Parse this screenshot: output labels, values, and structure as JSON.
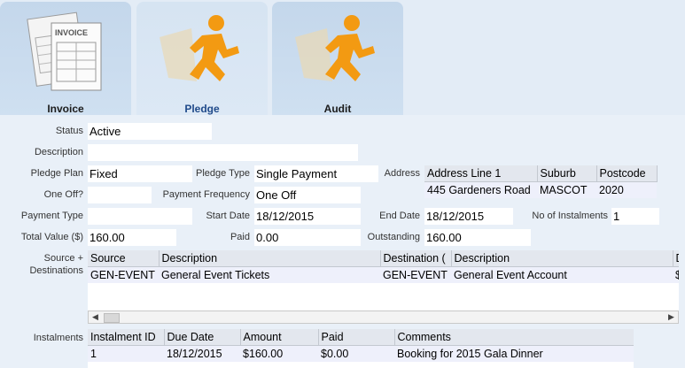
{
  "tabs": [
    {
      "label": "Invoice",
      "icon": "invoice-icon"
    },
    {
      "label": "Pledge",
      "icon": "running-man-icon"
    },
    {
      "label": "Audit",
      "icon": "running-man-icon"
    }
  ],
  "colors": {
    "accent": "#1f4a8a",
    "background": "#e3ecf6",
    "runner": "#f39a12"
  },
  "invoice_icon_text": "INVOICE",
  "form": {
    "status_label": "Status",
    "status": "Active",
    "description_label": "Description",
    "description": "",
    "pledge_plan_label": "Pledge Plan",
    "pledge_plan": "Fixed",
    "pledge_type_label": "Pledge Type",
    "pledge_type": "Single Payment",
    "address_label": "Address",
    "one_off_label": "One Off?",
    "one_off": "",
    "payment_frequency_label": "Payment Frequency",
    "payment_frequency": "One Off",
    "payment_type_label": "Payment Type",
    "payment_type": "",
    "start_date_label": "Start Date",
    "start_date": "18/12/2015",
    "end_date_label": "End Date",
    "end_date": "18/12/2015",
    "no_instalments_label": "No of Instalments",
    "no_instalments": "1",
    "total_value_label": "Total Value ($)",
    "total_value": "160.00",
    "paid_label": "Paid",
    "paid": "0.00",
    "outstanding_label": "Outstanding",
    "outstanding": "160.00"
  },
  "address_table": {
    "headers": [
      "Address Line 1",
      "Suburb",
      "Postcode"
    ],
    "row": [
      "445 Gardeners Road",
      "MASCOT",
      "2020"
    ]
  },
  "source_dest": {
    "label_line1": "Source +",
    "label_line2": "Destinations",
    "headers": [
      "Source",
      "Description",
      "Destination (",
      "Description",
      "D"
    ],
    "row": [
      "GEN-EVENT",
      "General Event Tickets",
      "GEN-EVENT",
      "General Event Account",
      "$"
    ]
  },
  "instalments": {
    "label": "Instalments",
    "headers": [
      "Instalment ID",
      "Due Date",
      "Amount",
      "Paid",
      "Comments"
    ],
    "row": [
      "1",
      "18/12/2015",
      "$160.00",
      "$0.00",
      "Booking for 2015 Gala Dinner"
    ]
  }
}
